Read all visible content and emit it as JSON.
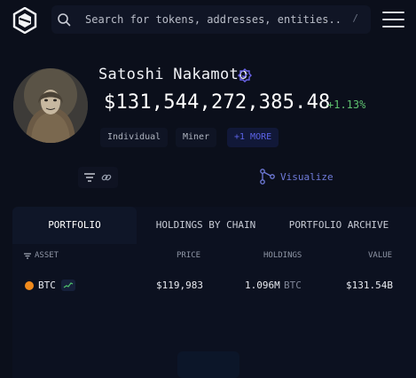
{
  "search": {
    "placeholder": "Search for tokens, addresses, entities...",
    "shortcut": "/"
  },
  "entity": {
    "name": "Satoshi Nakamoto",
    "balance": "$131,544,272,385.48",
    "change": "+1.13%",
    "tags": [
      "Individual",
      "Miner",
      "+1 MORE"
    ]
  },
  "actions": {
    "visualize_label": "Visualize"
  },
  "tabs": [
    "PORTFOLIO",
    "HOLDINGS BY CHAIN",
    "PORTFOLIO ARCHIVE"
  ],
  "table": {
    "headers": {
      "asset": "ASSET",
      "price": "PRICE",
      "holdings": "HOLDINGS",
      "value": "VALUE"
    },
    "rows": [
      {
        "asset": "BTC",
        "price": "$119,983",
        "holdings": "1.096M",
        "holdings_unit": "BTC",
        "value": "$131.54B"
      }
    ]
  },
  "colors": {
    "background": "#0b0f1b",
    "accent": "#5b62e6",
    "positive": "#5ec06f",
    "btc": "#f08a1c"
  },
  "icons": [
    "app-logo-icon",
    "search-icon",
    "hamburger-menu-icon",
    "verified-badge-icon",
    "filter-icon",
    "link-icon",
    "graph-icon",
    "sort-icon",
    "bitcoin-icon",
    "sparkline-icon"
  ]
}
